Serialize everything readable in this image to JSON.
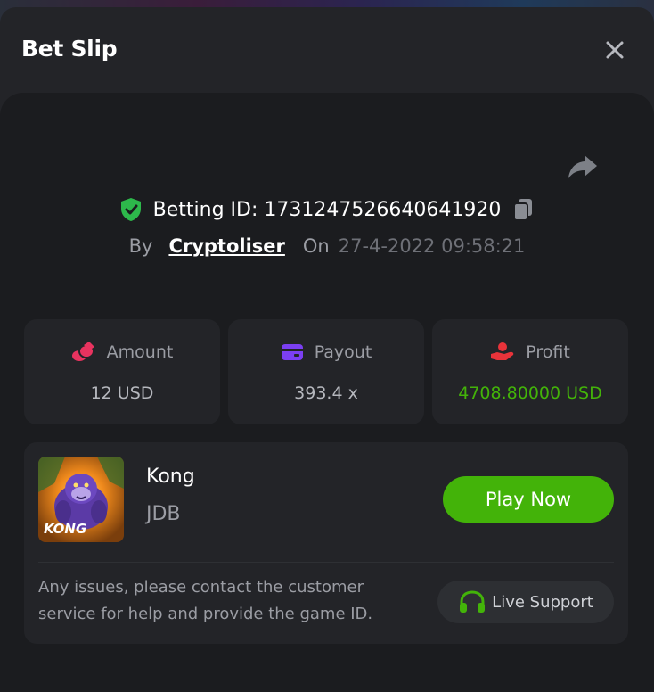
{
  "header": {
    "title": "Bet Slip"
  },
  "bet": {
    "id_label": "Betting ID:",
    "id_value": "1731247526640641920",
    "by_label": "By",
    "username": "Cryptoliser",
    "on_label": "On",
    "datetime": "27-4-2022 09:58:21"
  },
  "stats": [
    {
      "label": "Amount",
      "value": "12 USD",
      "icon": "coins-icon",
      "color": "#e8335f"
    },
    {
      "label": "Payout",
      "value": "393.4 x",
      "icon": "card-icon",
      "color": "#7b3ff2"
    },
    {
      "label": "Profit",
      "value": "4708.80000 USD",
      "icon": "hand-coin-icon",
      "color": "#e8333a"
    }
  ],
  "game": {
    "name": "Kong",
    "provider": "JDB",
    "thumbnail_text": "KONG",
    "play_label": "Play Now",
    "help_text": "Any issues, please contact the customer service for help and provide the game ID.",
    "support_label": "Live Support"
  },
  "colors": {
    "accent_green": "#43b309",
    "shield_green": "#2db84b",
    "panel_bg": "#1b1c1f",
    "card_bg": "#232428"
  }
}
